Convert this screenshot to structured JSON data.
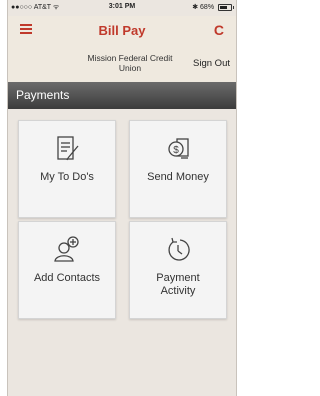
{
  "status_bar": {
    "carrier": "●●○○○ AT&T ᯤ",
    "time": "3:01 PM",
    "battery": "✱ 68%"
  },
  "nav": {
    "title": "Bill Pay",
    "menu_icon": "hamburger-icon",
    "refresh_icon": "refresh-icon",
    "refresh_glyph": "C",
    "accent_color": "#c0392b"
  },
  "subheader": {
    "org_name": "Mission Federal Credit Union",
    "sign_out": "Sign Out"
  },
  "section": {
    "title": "Payments"
  },
  "tiles": [
    {
      "label": "My To Do's",
      "icon": "todo-checklist-icon"
    },
    {
      "label": "Send Money",
      "icon": "send-money-icon"
    },
    {
      "label": "Add Contacts",
      "icon": "add-contact-icon"
    },
    {
      "label": "Payment Activity",
      "icon": "payment-history-icon"
    }
  ]
}
